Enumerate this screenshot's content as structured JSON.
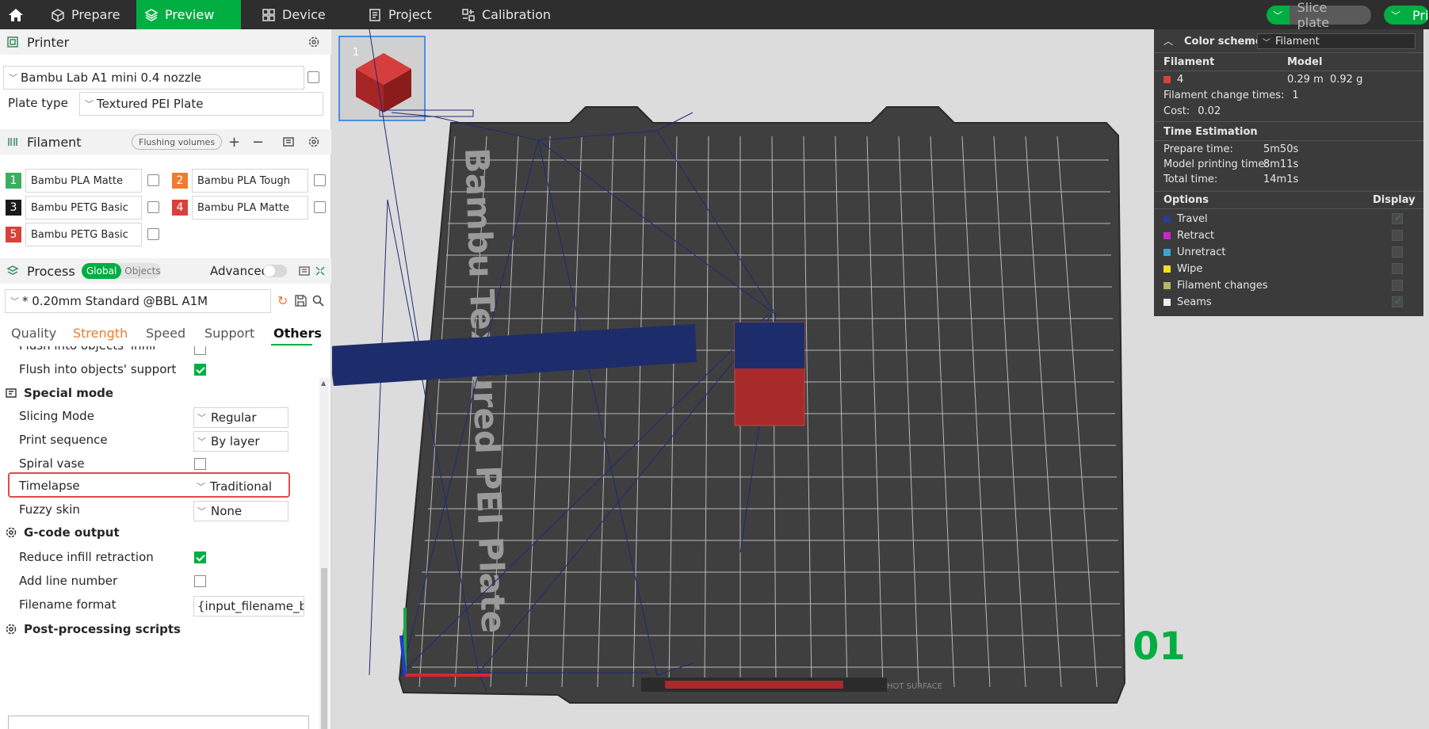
{
  "topbar": {
    "tabs": [
      {
        "label": "Prepare",
        "icon": "cube-icon"
      },
      {
        "label": "Preview",
        "icon": "layers-icon"
      },
      {
        "label": "Device",
        "icon": "device-icon"
      },
      {
        "label": "Project",
        "icon": "project-icon"
      },
      {
        "label": "Calibration",
        "icon": "calibration-icon"
      }
    ],
    "slice_label": "Slice plate",
    "print_label": "Pri"
  },
  "printer": {
    "title": "Printer",
    "name": "Bambu Lab A1 mini 0.4 nozzle",
    "plate_type_label": "Plate type",
    "plate_type": "Textured PEI Plate"
  },
  "filament": {
    "title": "Filament",
    "flushing_label": "Flushing volumes",
    "items": [
      {
        "num": "1",
        "name": "Bambu PLA Matte",
        "color": "#3dae5f"
      },
      {
        "num": "2",
        "name": "Bambu PLA Tough",
        "color": "#f07b31"
      },
      {
        "num": "3",
        "name": "Bambu PETG Basic",
        "color": "#1a1a1a"
      },
      {
        "num": "4",
        "name": "Bambu PLA Matte",
        "color": "#d9413a"
      },
      {
        "num": "5",
        "name": "Bambu PETG Basic",
        "color": "#d9413a"
      }
    ]
  },
  "process": {
    "title": "Process",
    "global_label": "Global",
    "objects_label": "Objects",
    "advanced_label": "Advanced",
    "preset": "* 0.20mm Standard @BBL A1M",
    "tabs": [
      "Quality",
      "Strength",
      "Speed",
      "Support",
      "Others"
    ],
    "rows": {
      "flush_infill": "Flush into objects' infill",
      "flush_support": "Flush into objects' support",
      "special_mode": "Special mode",
      "slicing_mode": "Slicing Mode",
      "slicing_mode_val": "Regular",
      "print_sequence": "Print sequence",
      "print_sequence_val": "By layer",
      "spiral_vase": "Spiral vase",
      "timelapse": "Timelapse",
      "timelapse_val": "Traditional",
      "fuzzy_skin": "Fuzzy skin",
      "fuzzy_skin_val": "None",
      "gcode_output": "G-code output",
      "reduce_infill": "Reduce infill retraction",
      "add_line_number": "Add line number",
      "filename_format": "Filename format",
      "filename_format_val": "{input_filename_b",
      "post_processing": "Post-processing scripts"
    }
  },
  "plate": {
    "thumb_num": "1",
    "plate_text": "Bambu Textured PEI Plate",
    "plate_index": "01",
    "hot_surface": "HOT SURFACE"
  },
  "legend": {
    "color_scheme_label": "Color scheme",
    "color_scheme_val": "Filament",
    "filament_col": "Filament",
    "model_col": "Model",
    "filament_id": "4",
    "filament_color": "#d9413a",
    "length": "0.29 m",
    "weight": "0.92 g",
    "change_times_label": "Filament change times:",
    "change_times": "1",
    "cost_label": "Cost:",
    "cost": "0.02",
    "time_title": "Time Estimation",
    "prepare_label": "Prepare time:",
    "prepare": "5m50s",
    "model_label": "Model printing time:",
    "model": "8m11s",
    "total_label": "Total time:",
    "total": "14m1s",
    "options_label": "Options",
    "display_label": "Display",
    "options": [
      {
        "name": "Travel",
        "color": "#2b3c8e",
        "on": true
      },
      {
        "name": "Retract",
        "color": "#c32bc8",
        "on": false
      },
      {
        "name": "Unretract",
        "color": "#3aa3d6",
        "on": false
      },
      {
        "name": "Wipe",
        "color": "#f2e01c",
        "on": false
      },
      {
        "name": "Filament changes",
        "color": "#b9b46a",
        "on": false
      },
      {
        "name": "Seams",
        "color": "#f0f0f0",
        "on": true
      }
    ]
  }
}
